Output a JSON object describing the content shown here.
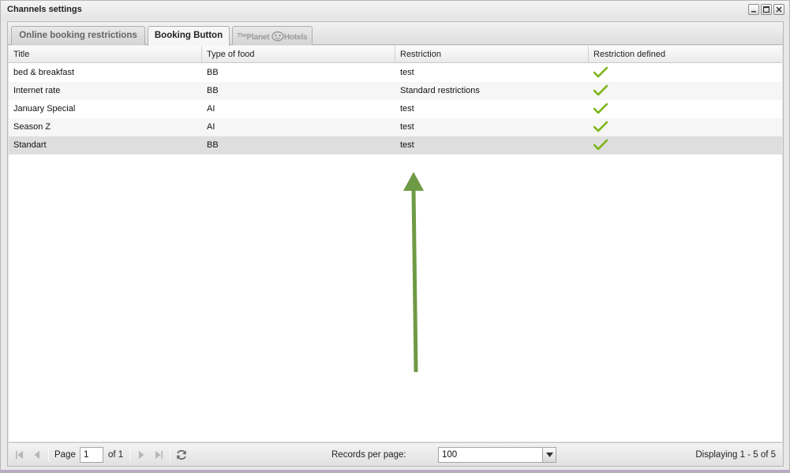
{
  "window": {
    "title": "Channels settings"
  },
  "tabs": [
    {
      "label": "Online booking restrictions",
      "active": false
    },
    {
      "label": "Booking Button",
      "active": true
    },
    {
      "logo_text_small": "The",
      "logo_text_1": "Planet",
      "logo_text_2": "Hotels",
      "active": false
    }
  ],
  "grid": {
    "columns": [
      "Title",
      "Type of food",
      "Restriction",
      "Restriction defined"
    ],
    "rows": [
      {
        "title": "bed & breakfast",
        "food": "BB",
        "restriction": "test",
        "defined": true
      },
      {
        "title": "Internet rate",
        "food": "BB",
        "restriction": "Standard restrictions",
        "defined": true
      },
      {
        "title": "January Special",
        "food": "AI",
        "restriction": "test",
        "defined": true
      },
      {
        "title": "Season Z",
        "food": "AI",
        "restriction": "test",
        "defined": true
      },
      {
        "title": "Standart",
        "food": "BB",
        "restriction": "test",
        "defined": true
      }
    ],
    "selected_row_index": 4
  },
  "paging": {
    "page_label": "Page",
    "page_value": "1",
    "of_label": "of 1",
    "records_label": "Records per page:",
    "records_value": "100",
    "displaying": "Displaying 1 - 5 of 5"
  },
  "colors": {
    "check": "#7cb518",
    "annotation_arrow": "#6f9a45"
  },
  "icons": [
    "minimize-icon",
    "maximize-icon",
    "close-icon",
    "check-icon",
    "first-page-icon",
    "prev-page-icon",
    "next-page-icon",
    "last-page-icon",
    "refresh-icon",
    "chevron-down-icon"
  ]
}
